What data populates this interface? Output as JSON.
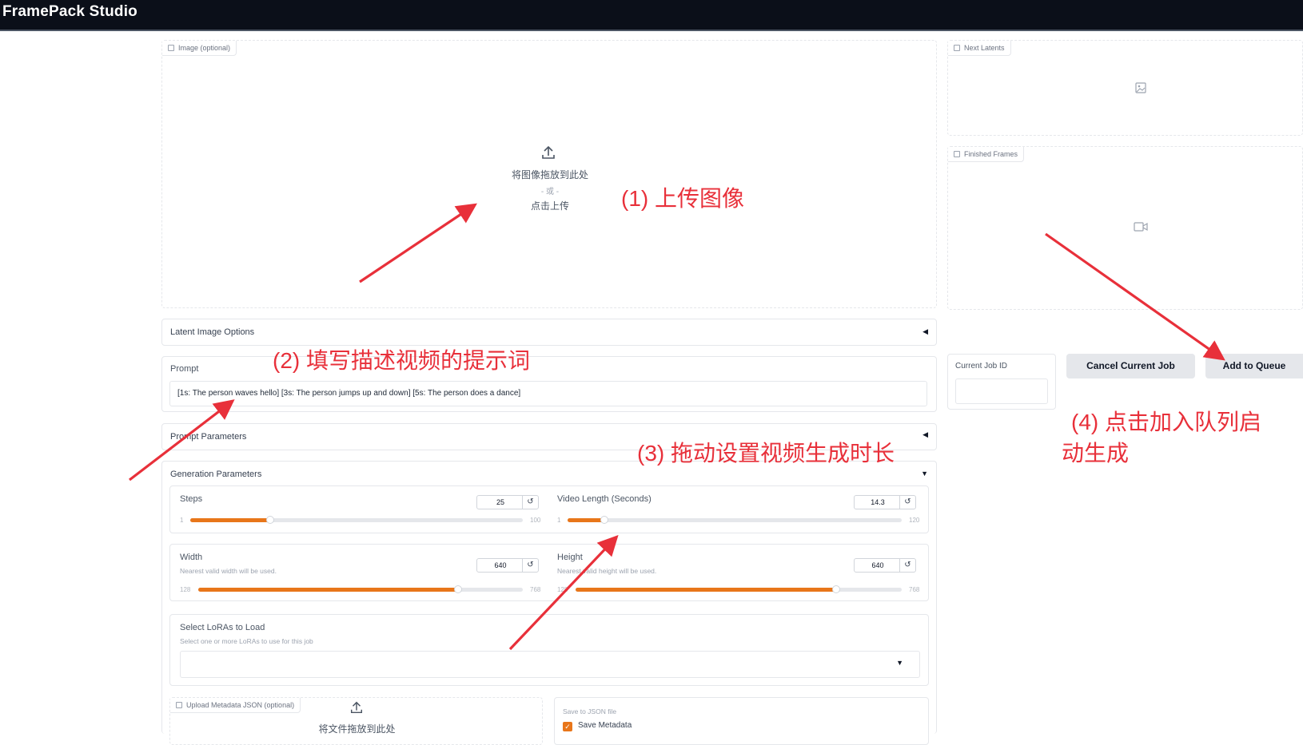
{
  "app": {
    "title": "FramePack Studio"
  },
  "image_upload": {
    "label": "Image (optional)",
    "drop_text": "将图像拖放到此处",
    "or_text": "- 或 -",
    "click_text": "点击上传"
  },
  "next_latents": {
    "label": "Next Latents"
  },
  "finished_frames": {
    "label": "Finished Frames"
  },
  "latent_options": {
    "label": "Latent Image Options"
  },
  "prompt": {
    "label": "Prompt",
    "value": "[1s: The person waves hello] [3s: The person jumps up and down] [5s: The person does a dance]"
  },
  "prompt_params": {
    "label": "Prompt Parameters"
  },
  "gen_params": {
    "label": "Generation Parameters",
    "steps": {
      "label": "Steps",
      "value": "25",
      "min": "1",
      "max": "100",
      "fraction": 0.24
    },
    "video_length": {
      "label": "Video Length (Seconds)",
      "value": "14.3",
      "min": "1",
      "max": "120",
      "fraction": 0.11
    },
    "width": {
      "label": "Width",
      "info": "Nearest valid width will be used.",
      "value": "640",
      "min": "128",
      "max": "768",
      "fraction": 0.8
    },
    "height": {
      "label": "Height",
      "info": "Nearest valid height will be used.",
      "value": "640",
      "min": "128",
      "max": "768",
      "fraction": 0.8
    }
  },
  "loras": {
    "label": "Select LoRAs to Load",
    "info": "Select one or more LoRAs to use for this job"
  },
  "metadata_upload": {
    "label": "Upload Metadata JSON (optional)",
    "drop_text": "将文件拖放到此处"
  },
  "save_json": {
    "label": "Save to JSON file",
    "checkbox_label": "Save Metadata",
    "checked": true
  },
  "job": {
    "label": "Current Job ID",
    "value": ""
  },
  "buttons": {
    "cancel": "Cancel Current Job",
    "add": "Add to Queue"
  },
  "annotations": {
    "step1": "(1) 上传图像",
    "step2": "(2) 填写描述视频的提示词",
    "step3": "(3) 拖动设置视频生成时长",
    "step4_line1": "(4) 点击加入队列启",
    "step4_line2": "动生成"
  },
  "colors": {
    "accent": "#e8761a",
    "annotation": "#e8303a",
    "topbar": "#0b0f19"
  }
}
